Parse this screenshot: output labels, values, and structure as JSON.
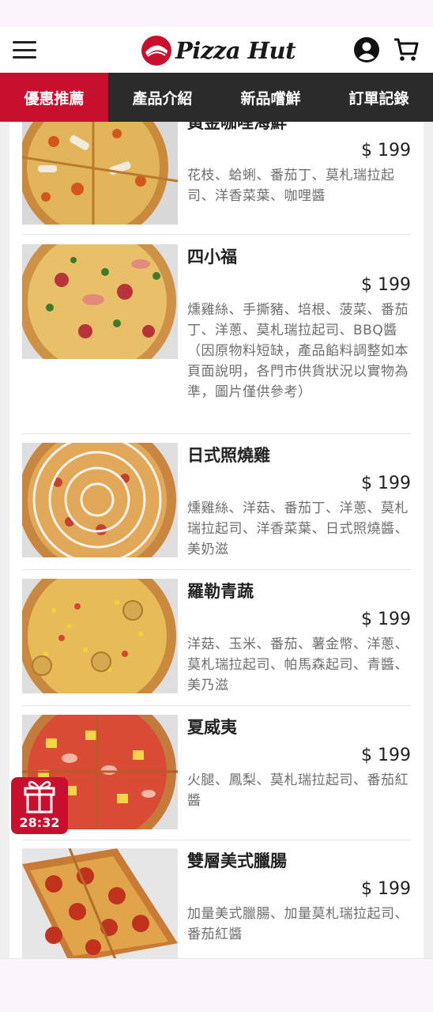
{
  "header": {
    "logo_text": "Pizza Hut"
  },
  "tabs": [
    {
      "label": "優惠推薦",
      "active": true
    },
    {
      "label": "產品介紹",
      "active": false
    },
    {
      "label": "新品嚐鮮",
      "active": false
    },
    {
      "label": "訂單記錄",
      "active": false
    }
  ],
  "products": [
    {
      "name": "黃金咖哩海鮮",
      "price": "$ 199",
      "desc": "花枝、蛤蜊、番茄丁、莫札瑞拉起司、洋香菜葉、咖哩醬",
      "note": ""
    },
    {
      "name": "四小福",
      "price": "$ 199",
      "desc": "燻雞絲、手撕豬、培根、菠菜、番茄丁、洋蔥、莫札瑞拉起司、BBQ醬",
      "note": "（因原物料短缺，產品餡料調整如本頁面說明，各門市供貨狀況以實物為準，圖片僅供參考）"
    },
    {
      "name": "日式照燒雞",
      "price": "$ 199",
      "desc": "燻雞絲、洋菇、番茄丁、洋蔥、莫札瑞拉起司、洋香菜葉、日式照燒醬、美奶滋",
      "note": ""
    },
    {
      "name": "羅勒青蔬",
      "price": "$ 199",
      "desc": "洋菇、玉米、番茄、薯金幣、洋蔥、莫札瑞拉起司、帕馬森起司、青醬、美乃滋",
      "note": ""
    },
    {
      "name": "夏威夷",
      "price": "$ 199",
      "desc": "火腿、鳳梨、莫札瑞拉起司、番茄紅醬",
      "note": ""
    },
    {
      "name": "雙層美式臘腸",
      "price": "$ 199",
      "desc": "加量美式臘腸、加量莫札瑞拉起司、番茄紅醬",
      "note": ""
    }
  ],
  "gift": {
    "timer": "28:32"
  },
  "colors": {
    "brand_red": "#c8102e",
    "tab_bar": "#2b2b2b"
  }
}
